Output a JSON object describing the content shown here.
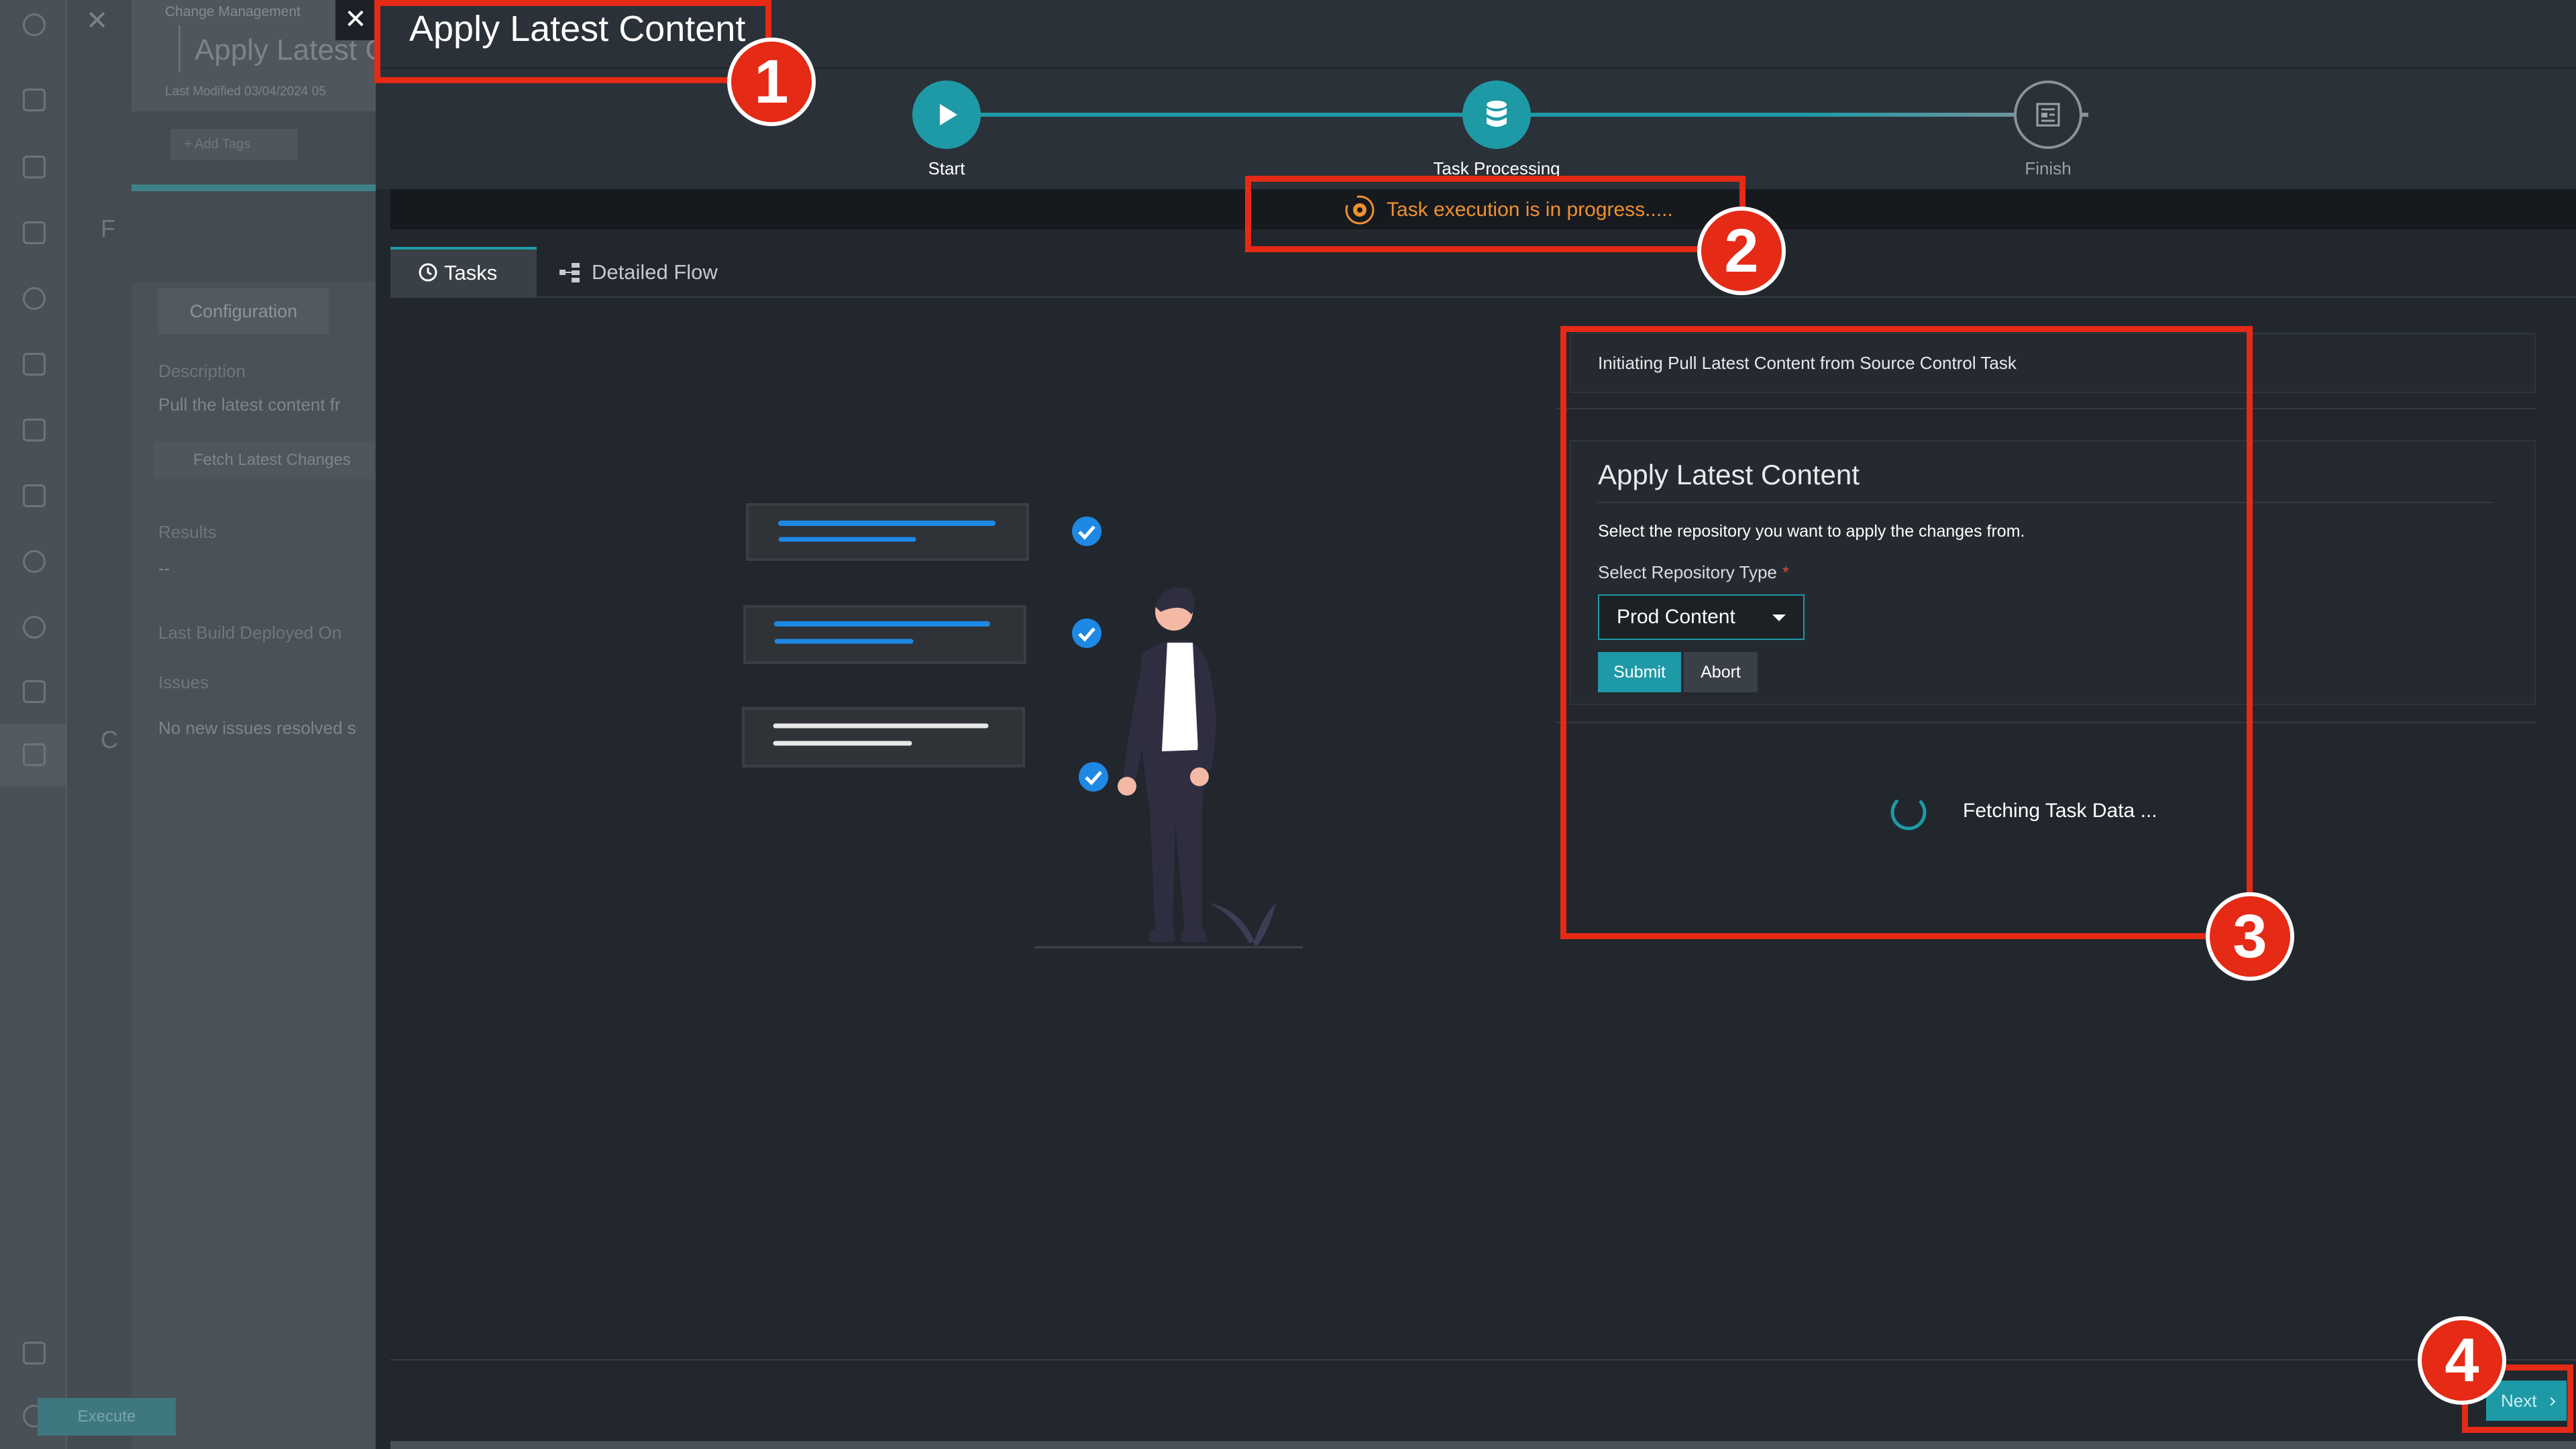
{
  "background_app": {
    "breadcrumb": "Change Management",
    "title": "Apply Latest C",
    "last_modified": "Last Modified 03/04/2024 05",
    "add_tags": "+ Add Tags",
    "config_tab": "Configuration",
    "description_label": "Description",
    "description_text": "Pull the latest content fr",
    "fetch_button": "Fetch Latest Changes",
    "results_label": "Results",
    "results_value": "--",
    "last_build_label": "Last Build Deployed On",
    "issues_label": "Issues",
    "issues_text": "No new issues resolved s",
    "execute_button": "Execute",
    "partial_letter_f": "F",
    "partial_letter_c": "C"
  },
  "modal": {
    "title": "Apply Latest Content",
    "steps": [
      {
        "label": "Start",
        "state": "done"
      },
      {
        "label": "Task Processing",
        "state": "active"
      },
      {
        "label": "Finish",
        "state": "pending"
      }
    ],
    "status": "Task execution is in progress.....",
    "tabs": [
      {
        "label": "Tasks",
        "active": true
      },
      {
        "label": "Detailed Flow",
        "active": false
      }
    ],
    "task_panel": {
      "initiating": "Initiating Pull Latest Content from Source Control Task",
      "form_title": "Apply Latest Content",
      "form_description": "Select the repository you want to apply the changes from.",
      "repo_label": "Select Repository Type",
      "required_mark": "*",
      "repo_value": "Prod Content",
      "submit_label": "Submit",
      "abort_label": "Abort",
      "fetching_label": "Fetching Task Data ..."
    },
    "next_label": "Next"
  },
  "annotations": [
    "1",
    "2",
    "3",
    "4"
  ],
  "colors": {
    "accent": "#1e9aa6",
    "status": "#f0902e",
    "annotation": "#e52a16",
    "modal_bg": "#22272e"
  },
  "icons": {
    "start": "play-icon",
    "task_processing": "database-icon",
    "finish": "report-icon",
    "status": "gear-sync-icon",
    "tasks_tab": "history-icon",
    "flow_tab": "flow-icon",
    "loading": "spinner-icon"
  }
}
